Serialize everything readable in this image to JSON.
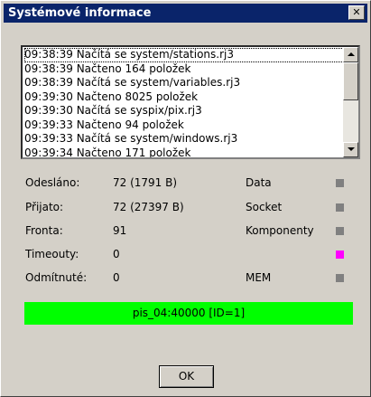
{
  "window": {
    "title": "Systémové informace",
    "close_symbol": "✕"
  },
  "log": {
    "lines": [
      "09:38:39 Načítá se system/stations.rj3",
      "09:38:39 Načteno 164 položek",
      "09:38:39 Načítá se system/variables.rj3",
      "09:39:30 Načteno 8025 položek",
      "09:39:30 Načítá se syspix/pix.rj3",
      "09:39:33 Načteno 94 položek",
      "09:39:33 Načítá se system/windows.rj3",
      "09:39:34 Načteno 171 položek"
    ]
  },
  "stats": [
    {
      "label": "Odesláno:",
      "value": "72 (1791 B)"
    },
    {
      "label": "Přijato:",
      "value": "72 (27397 B)"
    },
    {
      "label": "Fronta:",
      "value": "91"
    },
    {
      "label": "Timeouty:",
      "value": "0"
    },
    {
      "label": "Odmítnuté:",
      "value": "0"
    }
  ],
  "indicators": [
    {
      "label": "Data",
      "color": "#808080"
    },
    {
      "label": "Socket",
      "color": "#808080"
    },
    {
      "label": "Komponenty",
      "color": "#808080"
    },
    {
      "label": "",
      "color": "#ff00ff"
    },
    {
      "label": "MEM",
      "color": "#808080"
    }
  ],
  "status": {
    "text": "pis_04:40000 [ID=1]",
    "color": "#00ff00"
  },
  "buttons": {
    "ok_label": "OK"
  }
}
